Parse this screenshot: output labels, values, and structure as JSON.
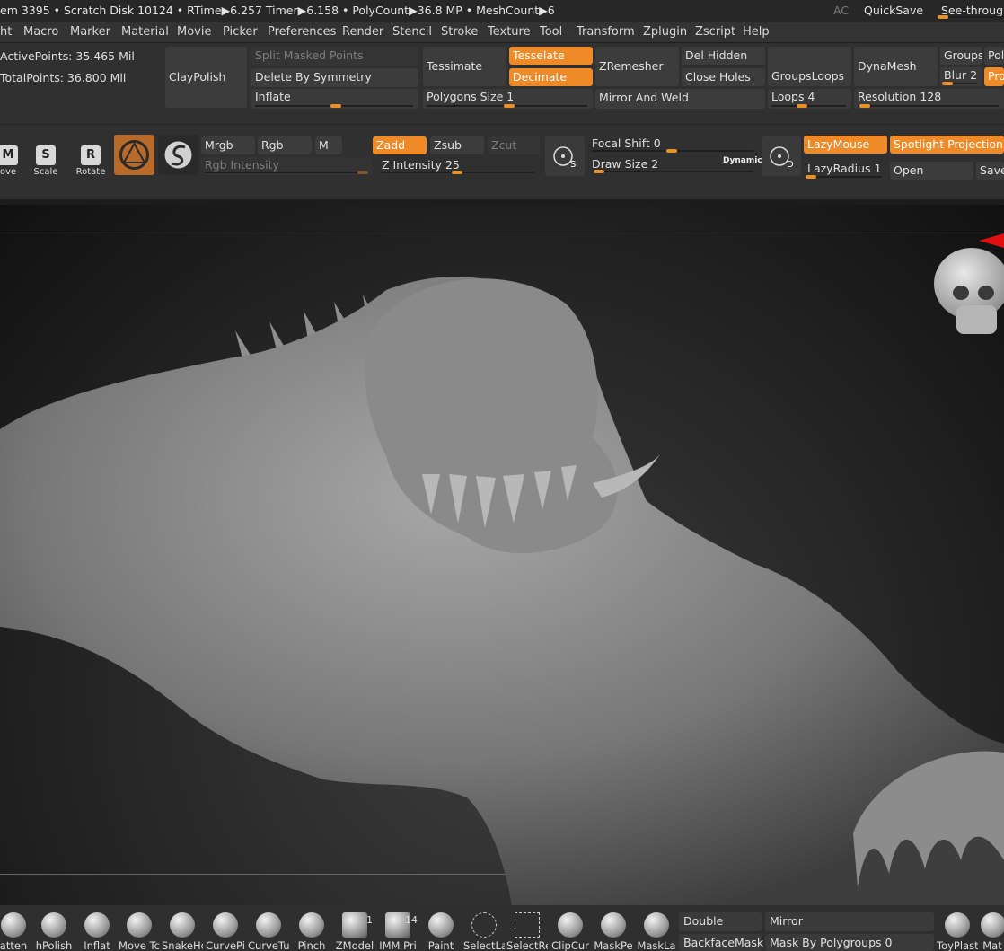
{
  "status": {
    "items": [
      "em 3395 • Scratch Disk 10124 •  RTime▶6.257 Timer▶6.158 • PolyCount▶36.8 MP  • MeshCount▶6"
    ],
    "ac": "AC",
    "quicksave": "QuickSave",
    "see_through": "See-through"
  },
  "menu": [
    "ht",
    "Macro",
    "Marker",
    "Material",
    "Movie",
    "Picker",
    "Preferences",
    "Render",
    "Stencil",
    "Stroke",
    "Texture",
    "Tool",
    "Transform",
    "Zplugin",
    "Zscript",
    "Help"
  ],
  "info": {
    "active_points": "ActivePoints: 35.465 Mil",
    "total_points": "TotalPoints: 36.800 Mil"
  },
  "palette": {
    "claypolish": "ClayPolish",
    "split_masked": "Split Masked Points",
    "delete_symmetry": "Delete By Symmetry",
    "inflate": "Inflate",
    "tessimate": "Tessimate",
    "tesselate": "Tesselate",
    "decimate": "Decimate",
    "polygons_size": "Polygons Size",
    "polygons_size_val": "1",
    "zremesher": "ZRemesher",
    "mirror_weld": "Mirror And Weld",
    "del_hidden": "Del Hidden",
    "close_holes": "Close Holes",
    "groupsloops": "GroupsLoops",
    "loops": "Loops",
    "loops_val": "4",
    "dynamesh": "DynaMesh",
    "resolution": "Resolution",
    "resolution_val": "128",
    "groups": "Groups",
    "poli": "Poli",
    "blur": "Blur",
    "blur_val": "2",
    "pro": "Pro"
  },
  "tools": [
    {
      "letter": "M",
      "label": "ove"
    },
    {
      "letter": "S",
      "label": "Scale"
    },
    {
      "letter": "R",
      "label": "Rotate"
    }
  ],
  "draw": {
    "mrgb": "Mrgb",
    "rgb": "Rgb",
    "m": "M",
    "rgb_intensity": "Rgb Intensity",
    "zadd": "Zadd",
    "zsub": "Zsub",
    "zcut": "Zcut",
    "z_intensity": "Z Intensity",
    "z_intensity_val": "25",
    "focal_shift": "Focal Shift",
    "focal_shift_val": "0",
    "draw_size": "Draw Size",
    "draw_size_val": "2",
    "dynamic": "Dynamic",
    "s_label": "S",
    "d_label": "D",
    "lazymouse": "LazyMouse",
    "spotlight": "Spotlight Projection",
    "lazyradius": "LazyRadius",
    "lazyradius_val": "1",
    "open": "Open",
    "save": "Save"
  },
  "bottom": {
    "brushes": [
      "atten",
      "hPolish",
      "Inflat",
      "Move Tc",
      "SnakeHo",
      "CurvePi",
      "CurveTu",
      "Pinch",
      "ZModel",
      "IMM Pri",
      "Paint",
      "SelectLa",
      "SelectRe",
      "ClipCur",
      "MaskPe",
      "MaskLa"
    ],
    "double": "Double",
    "mirror": "Mirror",
    "backface": "BackfaceMask",
    "mask_polygroups": "Mask By Polygroups",
    "mask_polygroups_val": "0",
    "toyplast": "ToyPlast",
    "mat": "Mat",
    "zmodel_num": "1",
    "imm_num": "14"
  },
  "colors": {
    "accent": "#ee8a27",
    "background": "#2b2b2b",
    "button": "#3c3c3c"
  }
}
